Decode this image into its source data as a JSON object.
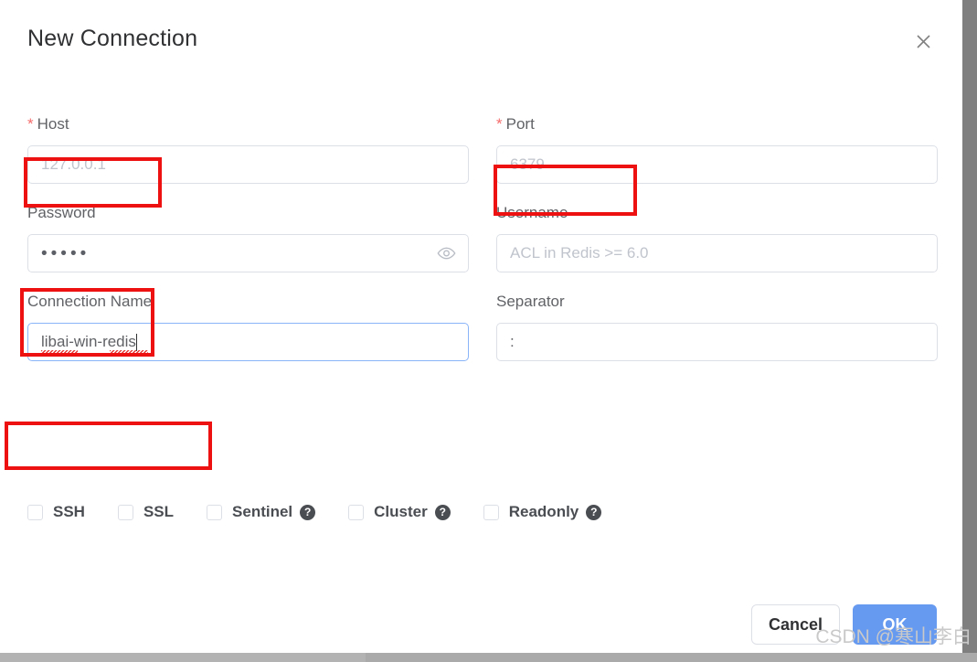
{
  "dialog": {
    "title": "New Connection",
    "close_icon": "close-icon"
  },
  "fields": {
    "host": {
      "label": "Host",
      "required_mark": "*",
      "placeholder": "127.0.0.1",
      "value": ""
    },
    "port": {
      "label": "Port",
      "required_mark": "*",
      "placeholder": "6379",
      "value": ""
    },
    "password": {
      "label": "Password",
      "value": "•••••",
      "reveal_icon": "eye-icon"
    },
    "username": {
      "label": "Username",
      "placeholder": "ACL in Redis >= 6.0",
      "value": ""
    },
    "connection_name": {
      "label": "Connection Name",
      "value": "libai-win-redis",
      "focused": true
    },
    "separator": {
      "label": "Separator",
      "value": ":"
    }
  },
  "checkboxes": [
    {
      "label": "SSH",
      "checked": false,
      "help": false
    },
    {
      "label": "SSL",
      "checked": false,
      "help": false
    },
    {
      "label": "Sentinel",
      "checked": false,
      "help": true,
      "help_glyph": "?"
    },
    {
      "label": "Cluster",
      "checked": false,
      "help": true,
      "help_glyph": "?"
    },
    {
      "label": "Readonly",
      "checked": false,
      "help": true,
      "help_glyph": "?"
    }
  ],
  "footer": {
    "cancel_label": "Cancel",
    "ok_label": "OK"
  },
  "watermark": "CSDN @寒山李白",
  "colors": {
    "accent": "#6699f0",
    "required": "#f56c6c",
    "annotation": "#ee1111",
    "focus_border": "#8ab4f8",
    "border": "#dcdfe6",
    "label": "#606266",
    "placeholder": "#c0c4cc"
  }
}
